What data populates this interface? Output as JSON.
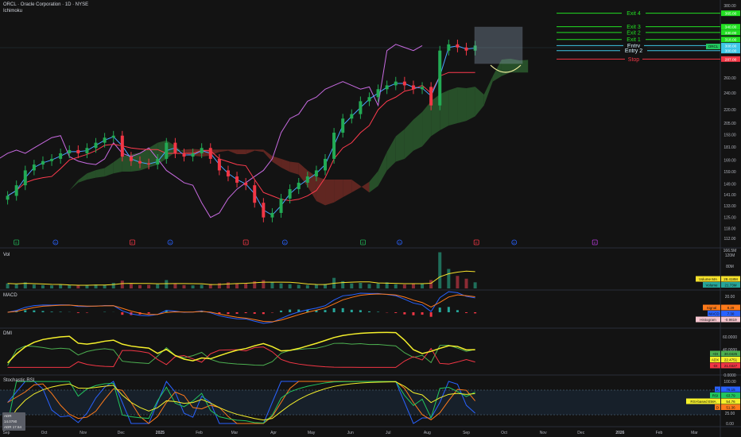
{
  "header": {
    "title": "ORCL · Oracle Corporation · 1D · NYSE",
    "indicator": "Ichimoku"
  },
  "colors": {
    "bg": "#131313",
    "up": "#22ab54",
    "down": "#f23645",
    "tenkan": "#4aa3ff",
    "kijun": "#ff3b4e",
    "lagging": "#c76ae0",
    "cloud_up": "#2b5a2e",
    "cloud_down": "#6e2a24",
    "exit": "#22e022",
    "entry": "#3ec7e6",
    "stop": "#f23645"
  },
  "chart_data": [
    {
      "type": "candlestick",
      "title": "ORCL · Oracle Corporation · 1D · NYSE",
      "scale": "log",
      "ylim": [
        112,
        380
      ],
      "y_ticks": [
        380,
        260,
        240,
        220,
        205,
        193,
        181,
        169,
        159,
        149,
        141,
        133,
        125,
        118,
        112
      ],
      "x_ticks": [
        {
          "label": "Sep",
          "date": "2024-09-01"
        },
        {
          "label": "Oct",
          "date": "2024-10-01"
        },
        {
          "label": "Nov",
          "date": "2024-11-01"
        },
        {
          "label": "Dec",
          "date": "2024-12-01"
        },
        {
          "label": "2025",
          "date": "2025-01-01"
        },
        {
          "label": "Feb",
          "date": "2025-02-01"
        },
        {
          "label": "Mar",
          "date": "2025-03-01"
        },
        {
          "label": "Apr",
          "date": "2025-04-01"
        },
        {
          "label": "May",
          "date": "2025-05-01"
        },
        {
          "label": "Jun",
          "date": "2025-06-01"
        },
        {
          "label": "Jul",
          "date": "2025-07-01"
        },
        {
          "label": "Aug",
          "date": "2025-08-01"
        },
        {
          "label": "Sep",
          "date": "2025-09-01"
        },
        {
          "label": "Oct",
          "date": "2025-10-01"
        },
        {
          "label": "Nov",
          "date": "2025-11-01"
        },
        {
          "label": "Dec",
          "date": "2025-12-01"
        },
        {
          "label": "2026",
          "date": "2026-01-01"
        },
        {
          "label": "Feb",
          "date": "2026-02-01"
        },
        {
          "label": "Mar",
          "date": "2026-03-01"
        }
      ],
      "start_date": "2024-09-02",
      "closes": [
        140,
        148,
        160,
        165,
        168,
        170,
        175,
        178,
        175,
        180,
        185,
        190,
        192,
        172,
        168,
        166,
        165,
        170,
        185,
        175,
        172,
        175,
        180,
        170,
        160,
        155,
        150,
        148,
        135,
        125,
        128,
        138,
        145,
        150,
        155,
        160,
        170,
        195,
        210,
        215,
        230,
        235,
        245,
        250,
        255,
        250,
        245,
        248,
        225,
        300,
        310,
        305,
        300,
        308
      ],
      "volumes_m": [
        18,
        15,
        22,
        14,
        12,
        11,
        13,
        12,
        10,
        12,
        14,
        13,
        20,
        28,
        16,
        12,
        13,
        15,
        30,
        18,
        12,
        11,
        13,
        16,
        19,
        22,
        18,
        17,
        26,
        30,
        22,
        18,
        15,
        13,
        12,
        14,
        16,
        38,
        26,
        18,
        20,
        16,
        18,
        22,
        15,
        14,
        16,
        18,
        30,
        130,
        70,
        45,
        35,
        22
      ],
      "trade_levels": [
        {
          "label": "Exit 4",
          "price": 365,
          "price_label": "365.00",
          "kind": "exit"
        },
        {
          "label": "Exit 3",
          "price": 340,
          "price_label": "340.00",
          "kind": "exit"
        },
        {
          "label": "Exit 2",
          "price": 330,
          "price_label": "330.00",
          "kind": "exit"
        },
        {
          "label": "Exit 1",
          "price": 318,
          "price_label": "318.00",
          "kind": "exit"
        },
        {
          "label": "Entry",
          "price": 308,
          "price_label": "308.00",
          "kind": "entry"
        },
        {
          "label": "Entry 2",
          "price": 300,
          "price_label": "300.00",
          "kind": "entry"
        },
        {
          "label": "Stop",
          "price": 287,
          "price_label": "287.00",
          "kind": "stop"
        }
      ],
      "last_price": {
        "symbol": "ORCL",
        "price_label": "308.00"
      },
      "events": [
        {
          "date": "2024-09-09",
          "letter": "E",
          "kind": "earnings-up"
        },
        {
          "date": "2024-10-10",
          "letter": "D",
          "kind": "dividend"
        },
        {
          "date": "2024-12-10",
          "letter": "E",
          "kind": "earnings-down"
        },
        {
          "date": "2025-01-09",
          "letter": "D",
          "kind": "dividend"
        },
        {
          "date": "2025-03-10",
          "letter": "E",
          "kind": "earnings-down"
        },
        {
          "date": "2025-04-10",
          "letter": "D",
          "kind": "dividend"
        },
        {
          "date": "2025-06-11",
          "letter": "E",
          "kind": "earnings-up"
        },
        {
          "date": "2025-07-10",
          "letter": "D",
          "kind": "dividend"
        },
        {
          "date": "2025-09-09",
          "letter": "E",
          "kind": "earnings-down"
        },
        {
          "date": "2025-10-09",
          "letter": "D",
          "kind": "dividend"
        },
        {
          "date": "2025-12-12",
          "letter": "E",
          "kind": "earnings-upcoming"
        }
      ]
    },
    {
      "type": "bar",
      "title": "Vol",
      "y_ticks": [
        {
          "v": 120,
          "l": "120M"
        },
        {
          "v": 80,
          "l": "80M"
        }
      ],
      "top_label": "166.5M",
      "legend": [
        {
          "name": "Volume MA",
          "value": "28.418M",
          "color": "#f5e12b"
        },
        {
          "name": "Volume",
          "value": "21.73M",
          "color": "#26a69a"
        }
      ]
    },
    {
      "type": "line",
      "title": "MACD",
      "y_ticks": [
        {
          "v": 20,
          "l": "20.00"
        },
        {
          "v": -10,
          "l": "-10.00"
        }
      ],
      "legend": [
        {
          "name": "Signal",
          "value": "8.29",
          "color": "#ff7a1a"
        },
        {
          "name": "MACD",
          "value": "7.30",
          "color": "#2962ff"
        },
        {
          "name": "Histogram",
          "value": "-0.9819",
          "color": "#f7c6cf"
        }
      ]
    },
    {
      "type": "line",
      "title": "DMI",
      "y_ticks": [
        {
          "v": 60,
          "l": "60.0000"
        },
        {
          "v": 40,
          "l": "40.0000"
        },
        {
          "v": 0,
          "l": "0.0000"
        }
      ],
      "legend": [
        {
          "name": "+DI",
          "value": "30.0425",
          "color": "#4caf50"
        },
        {
          "name": "ADX",
          "value": "22.4751",
          "color": "#f5f02b"
        },
        {
          "name": "-DI",
          "value": "21.0327",
          "color": "#f23645"
        }
      ]
    },
    {
      "type": "line",
      "title": "Stochastic RSI",
      "y_ticks": [
        {
          "v": 100,
          "l": "100.00"
        },
        {
          "v": 25,
          "l": "25.00"
        },
        {
          "v": 0,
          "l": "0.00"
        }
      ],
      "legend": [
        {
          "name": "K",
          "value": "76.15",
          "color": "#2962ff"
        },
        {
          "name": "RSI",
          "value": "63.79",
          "color": "#22c55e"
        },
        {
          "name": "RSI-based EMA",
          "value": "54.76",
          "color": "#f5f02b"
        },
        {
          "name": "D",
          "value": "51.36",
          "color": "#ff7a1a"
        }
      ],
      "adr": [
        "ADR 14.0790",
        "ADR 17.54"
      ]
    }
  ]
}
